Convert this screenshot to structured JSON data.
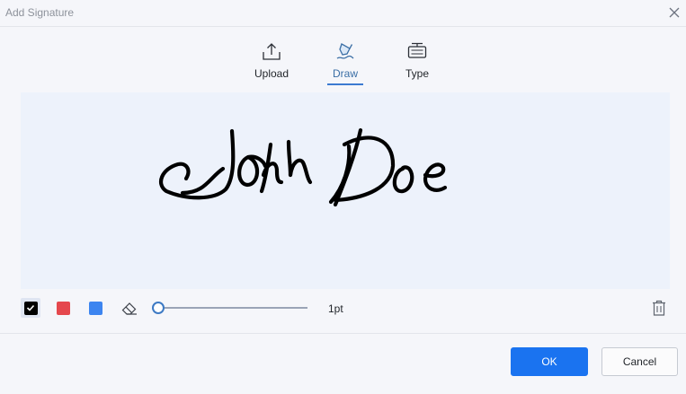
{
  "dialog": {
    "title": "Add Signature"
  },
  "tabs": [
    {
      "label": "Upload",
      "icon": "upload-icon"
    },
    {
      "label": "Draw",
      "icon": "pen-icon",
      "active": true
    },
    {
      "label": "Type",
      "icon": "keyboard-icon"
    }
  ],
  "toolbar": {
    "colors": [
      "#000000",
      "#e5484d",
      "#3d85f0"
    ],
    "selected_color": "#000000",
    "stroke_size_label": "1pt",
    "stroke_size_slider_fraction": 0.0
  },
  "footer": {
    "ok_label": "OK",
    "cancel_label": "Cancel"
  },
  "theme": {
    "accent": "#1a73f0",
    "canvas_bg": "#edf2fb"
  }
}
